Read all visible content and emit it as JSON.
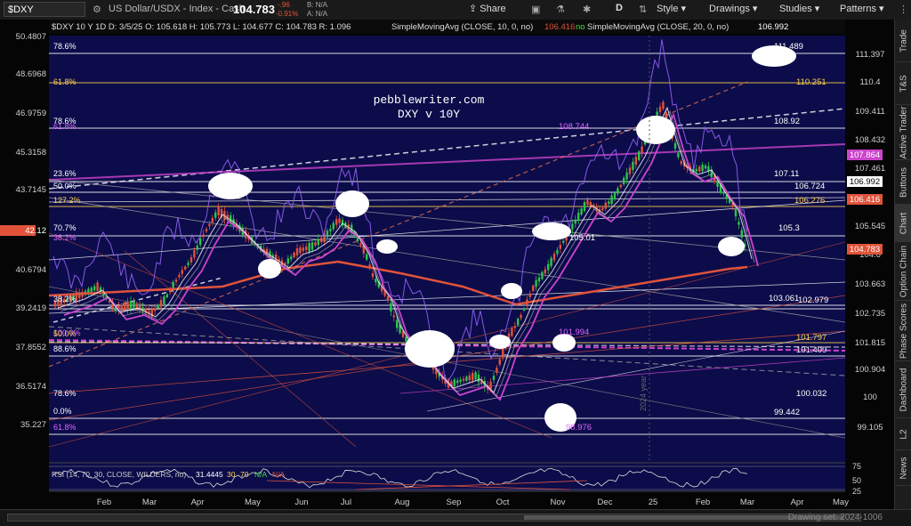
{
  "toolbar": {
    "symbol": "$DXY",
    "name": "US Dollar/USDX - Index - Cash",
    "price": "104.783",
    "change": "-.96",
    "change_pct": "-0.91%",
    "bid": "B: N/A",
    "ask": "A: N/A",
    "share": "Share",
    "period": "D",
    "style": "Style",
    "drawings": "Drawings",
    "studies": "Studies",
    "patterns": "Patterns"
  },
  "legend": {
    "ohlc": "$DXY 10 Y 1D  D: 3/5/25  O: 105.618  H: 105.773  L: 104.677  C: 104.783  R: 1.096",
    "sma10": "SimpleMovingAvg (CLOSE, 10, 0, no)",
    "sma10_val": "106.416",
    "sma20": "SimpleMovingAvg (CLOSE, 20, 0, no)",
    "sma20_val": "106.992",
    "no": "no"
  },
  "annotation": {
    "line1": "pebblewriter.com",
    "line2": "DXY v 10Y",
    "year": "2024 year"
  },
  "left_axis": [
    "50.4807",
    "48.6968",
    "46.9759",
    "45.3158",
    "43.7145",
    "42.12",
    "40.6794",
    "39.2419",
    "37.8552",
    "36.5174",
    "35.227"
  ],
  "right_axis": [
    "111.397",
    "110.4",
    "109.411",
    "108.432",
    "107.461",
    "105.545",
    "104.6",
    "103.663",
    "102.735",
    "101.815",
    "100.904",
    "100",
    "99.105"
  ],
  "price_tags": [
    {
      "text": "107.864",
      "bg": "#cc44cc"
    },
    {
      "text": "106.992",
      "bg": "#ffffff"
    },
    {
      "text": "106.416",
      "bg": "#e0533a"
    },
    {
      "text": "104.783",
      "bg": "#e0533a"
    }
  ],
  "fib_labels": [
    "78.6%",
    "61.8%",
    "78.6%",
    "61.8%",
    "23.6%",
    "50.0%",
    "127.2%",
    "70.7%",
    "38.2%",
    "38.2%",
    "100.0%",
    "88.6%",
    "78.6%",
    "0.0%",
    "61.8%",
    "50.0%"
  ],
  "level_labels": [
    {
      "text": "111.489",
      "color": "#ffffff"
    },
    {
      "text": "110.251",
      "color": "#ffd24a"
    },
    {
      "text": "108.92",
      "color": "#ffffff"
    },
    {
      "text": "108.744",
      "color": "#e066ff"
    },
    {
      "text": "107.11",
      "color": "#ffffff"
    },
    {
      "text": "106.724",
      "color": "#ffffff"
    },
    {
      "text": "106.276",
      "color": "#ffd24a"
    },
    {
      "text": "105.3",
      "color": "#ffffff"
    },
    {
      "text": "105.01",
      "color": "#ffffff"
    },
    {
      "text": "103.061",
      "color": "#ffffff"
    },
    {
      "text": "102.979",
      "color": "#ffffff"
    },
    {
      "text": "101.994",
      "color": "#e066ff"
    },
    {
      "text": "101.797",
      "color": "#ffd24a"
    },
    {
      "text": "101.409",
      "color": "#ffffff"
    },
    {
      "text": "100.032",
      "color": "#ffffff"
    },
    {
      "text": "99.442",
      "color": "#ffffff"
    },
    {
      "text": "98.976",
      "color": "#e066ff"
    }
  ],
  "months": [
    "Feb",
    "Mar",
    "Apr",
    "May",
    "Jun",
    "Jul",
    "Aug",
    "Sep",
    "Oct",
    "Nov",
    "Dec",
    "25",
    "Feb",
    "Mar",
    "Apr",
    "May"
  ],
  "rsi": {
    "label": "RSI (14, 70, 30, CLOSE, WILDERS, no)",
    "value": "31.4445",
    "ob": "30",
    "os": "70",
    "na1": "N/A",
    "na2": "N/A",
    "ticks": [
      "75",
      "50",
      "25"
    ]
  },
  "right_tabs": [
    "Trade",
    "T&S",
    "Active Trader",
    "Buttons",
    "Chart",
    "Option Chain",
    "Phase Scores",
    "Dashboard",
    "L2",
    "News"
  ],
  "bottom": {
    "drawing_set": "Drawing set: 2024-1006"
  },
  "colors": {
    "bg": "#0c0c4a",
    "price": "#e0533a",
    "sma": "#cc44cc",
    "fib_gold": "#ffd24a"
  }
}
